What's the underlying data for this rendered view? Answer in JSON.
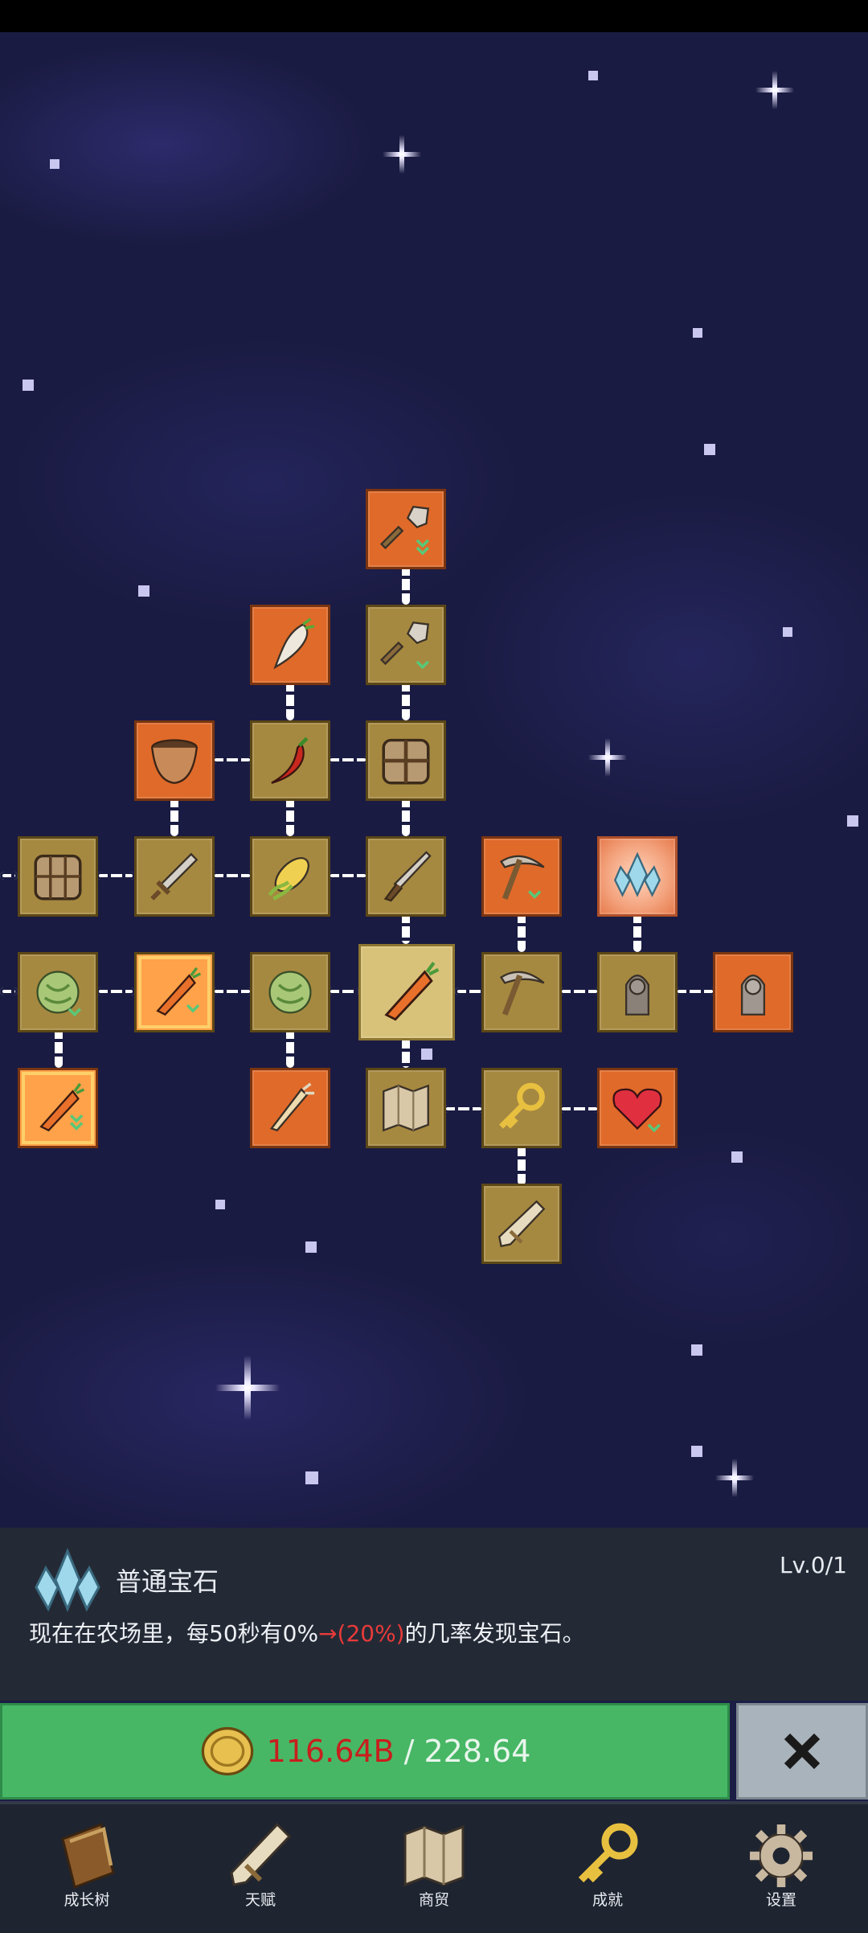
{
  "info": {
    "title": "普通宝石",
    "level": "Lv.0/1",
    "desc_before": "现在在农场里，每50秒有0%",
    "desc_highlight": "→(20%)",
    "desc_after": "的几率发现宝石。"
  },
  "upgrade": {
    "current": "116.64B",
    "separator": "/",
    "total": "228.64"
  },
  "nav": [
    {
      "label": "成长树",
      "icon": "book-icon"
    },
    {
      "label": "天赋",
      "icon": "scroll-icon"
    },
    {
      "label": "商贸",
      "icon": "map-icon"
    },
    {
      "label": "成就",
      "icon": "key-icon"
    },
    {
      "label": "设置",
      "icon": "gear-icon"
    }
  ],
  "colors": {
    "node_gold": "#a68940",
    "node_orange": "#e06a2a",
    "upgrade_green": "#47b765",
    "cost_red": "#c81e1e",
    "highlight_red": "#e83a3a"
  }
}
